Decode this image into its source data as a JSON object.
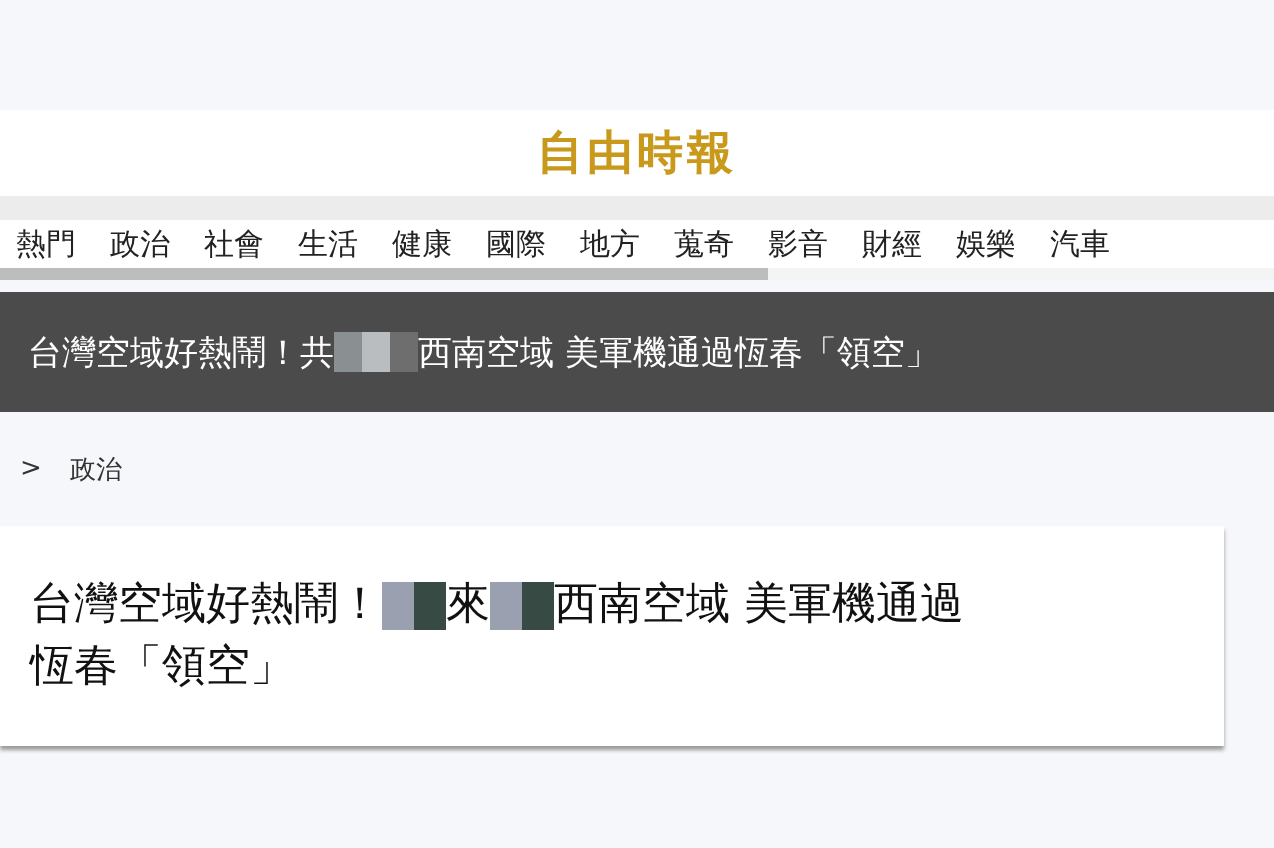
{
  "logo": "自由時報",
  "nav": [
    {
      "label": "熱門"
    },
    {
      "label": "政治"
    },
    {
      "label": "社會"
    },
    {
      "label": "生活"
    },
    {
      "label": "健康"
    },
    {
      "label": "國際"
    },
    {
      "label": "地方"
    },
    {
      "label": "蒐奇"
    },
    {
      "label": "影音"
    },
    {
      "label": "財經"
    },
    {
      "label": "娛樂"
    },
    {
      "label": "汽車"
    }
  ],
  "banner": {
    "parts": [
      {
        "kind": "text",
        "text": "台灣空域好熱鬧！共"
      },
      {
        "kind": "mosaic"
      },
      {
        "kind": "text",
        "text": "西南空域 美軍機通過恆春「領空」"
      }
    ]
  },
  "breadcrumb": {
    "separator": ">",
    "section": "政治"
  },
  "headline": {
    "parts": [
      {
        "kind": "text",
        "text": "台灣空域好熱鬧！"
      },
      {
        "kind": "mosaic"
      },
      {
        "kind": "text",
        "text": "來"
      },
      {
        "kind": "mosaic"
      },
      {
        "kind": "text",
        "text": "西南空域 美軍機通過"
      },
      {
        "kind": "break"
      },
      {
        "kind": "text",
        "text": "恆春「領空」"
      }
    ]
  }
}
